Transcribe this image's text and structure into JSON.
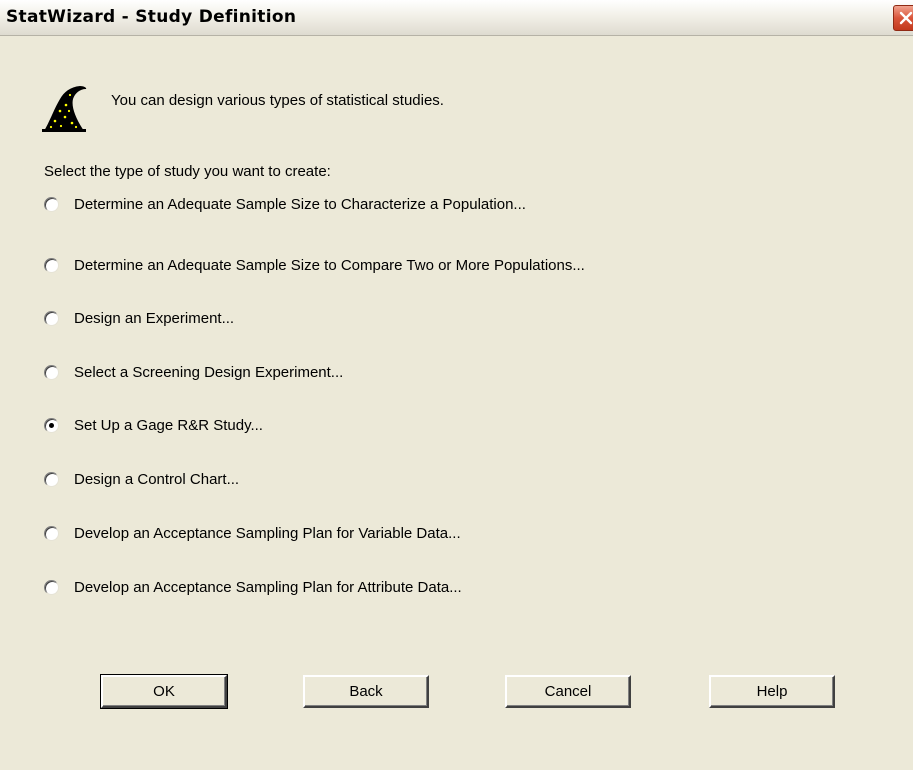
{
  "window": {
    "title": "StatWizard - Study Definition"
  },
  "intro_text": "You can design various types of statistical studies.",
  "prompt": "Select the type of study you want to create:",
  "options": [
    {
      "label": "Determine an Adequate Sample Size to Characterize a Population...",
      "selected": false
    },
    {
      "label": "Determine an Adequate Sample Size to Compare Two or More Populations...",
      "selected": false
    },
    {
      "label": "Design an Experiment...",
      "selected": false
    },
    {
      "label": "Select a Screening Design Experiment...",
      "selected": false
    },
    {
      "label": "Set Up a Gage R&R Study...",
      "selected": true
    },
    {
      "label": "Design a Control Chart...",
      "selected": false
    },
    {
      "label": "Develop an Acceptance Sampling Plan for Variable Data...",
      "selected": false
    },
    {
      "label": "Develop an Acceptance Sampling Plan for Attribute Data...",
      "selected": false
    }
  ],
  "buttons": {
    "ok": "OK",
    "back": "Back",
    "cancel": "Cancel",
    "help": "Help"
  },
  "icons": {
    "wizard": "wizard-hat-icon",
    "close": "close-icon"
  },
  "colors": {
    "dialog_background": "#ece9d8",
    "close_button": "#d9553a",
    "wizard_hat": "#000000",
    "wizard_stars": "#ffff00"
  }
}
